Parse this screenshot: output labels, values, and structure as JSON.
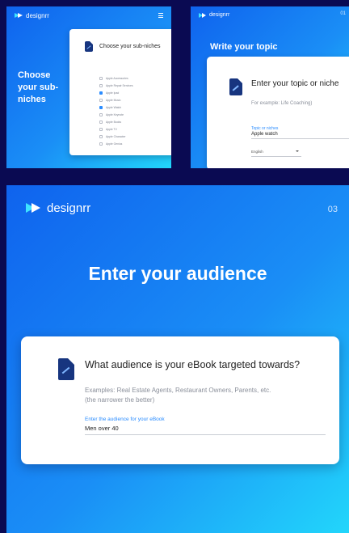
{
  "brand": {
    "name": "designrr"
  },
  "colors": {
    "accent": "#2a8cff",
    "icon_dark": "#17357f",
    "background": "#0a0a52"
  },
  "icons": [
    "designrr-logo-icon",
    "menu-icon",
    "document-icon"
  ],
  "panel_subniches": {
    "title": "Choose your sub-niches",
    "card_title": "Choose your sub-niches",
    "options": [
      {
        "label": "Apple Accessories",
        "checked": false
      },
      {
        "label": "Apple Repair Services",
        "checked": false
      },
      {
        "label": "Apple Ipad",
        "checked": true
      },
      {
        "label": "Apple Music",
        "checked": false
      },
      {
        "label": "Apple Watch",
        "checked": true
      },
      {
        "label": "Apple Keynote",
        "checked": false
      },
      {
        "label": "Apple Books",
        "checked": false
      },
      {
        "label": "Apple TV",
        "checked": false
      },
      {
        "label": "Apple Character",
        "checked": false
      },
      {
        "label": "Apple Genius",
        "checked": false
      }
    ]
  },
  "panel_topic": {
    "step": "01",
    "heading": "Write your topic",
    "card_title": "Enter your topic or niche",
    "hint": "For example: Life Coaching)",
    "field_label": "Topic or niches",
    "field_value": "Apple watch",
    "language": "English"
  },
  "panel_audience": {
    "step": "03",
    "heading": "Enter your audience",
    "card_title": "What audience is your eBook targeted towards?",
    "hint_line1": "Examples: Real Estate Agents, Restaurant Owners, Parents, etc.",
    "hint_line2": "(the narrower the better)",
    "field_label": "Enter the audience for your eBook",
    "field_value": "Men over 40"
  }
}
